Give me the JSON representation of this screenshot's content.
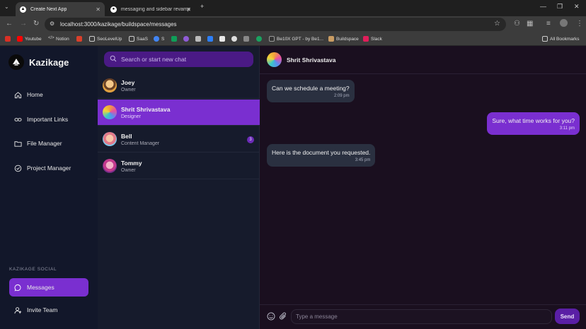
{
  "browser": {
    "tabs": [
      {
        "title": "Create Next App",
        "active": true
      },
      {
        "title": "messaging and sidebar revamp",
        "active": false
      }
    ],
    "url": "localhost:3000/kazikage/buildspace/messages",
    "bookmarks": [
      "Youtube",
      "Notion",
      "SeoLevelUp",
      "SaaS",
      "S",
      "Be10X GPT - by Be1...",
      "Buildspace",
      "Slack"
    ],
    "all_bookmarks": "All Bookmarks"
  },
  "sidebar": {
    "brand": "Kazikage",
    "items": [
      {
        "label": "Home",
        "icon": "home-icon"
      },
      {
        "label": "Important Links",
        "icon": "link-icon"
      },
      {
        "label": "File Manager",
        "icon": "folder-icon"
      },
      {
        "label": "Project Manager",
        "icon": "check-circle-icon"
      }
    ],
    "social_label": "KAZIKAGE SOCIAL",
    "social_items": [
      {
        "label": "Messages",
        "icon": "message-icon",
        "active": true
      },
      {
        "label": "Invite Team",
        "icon": "user-add-icon",
        "active": false
      }
    ]
  },
  "chatlist": {
    "search_placeholder": "Search or start new chat",
    "contacts": [
      {
        "name": "Joey",
        "role": "Owner",
        "badge": null
      },
      {
        "name": "Shrit Shrivastava",
        "role": "Designer",
        "badge": null,
        "active": true
      },
      {
        "name": "Bell",
        "role": "Content Manager",
        "badge": "3"
      },
      {
        "name": "Tommy",
        "role": "Owner",
        "badge": null
      }
    ]
  },
  "chat": {
    "header_name": "Shrit Shrivastava",
    "messages": [
      {
        "text": "Can we schedule a meeting?",
        "time": "2:09 pm",
        "direction": "in"
      },
      {
        "text": "Sure, what time works for you?",
        "time": "3:11 pm",
        "direction": "out"
      },
      {
        "text": "Here is the document you requested.",
        "time": "3:45 pm",
        "direction": "in"
      }
    ],
    "input_placeholder": "Type a message",
    "send_label": "Send"
  },
  "colors": {
    "accent": "#7a2fd0",
    "sidebar_bg": "#12172a",
    "chat_bg": "#1a0f1f"
  }
}
